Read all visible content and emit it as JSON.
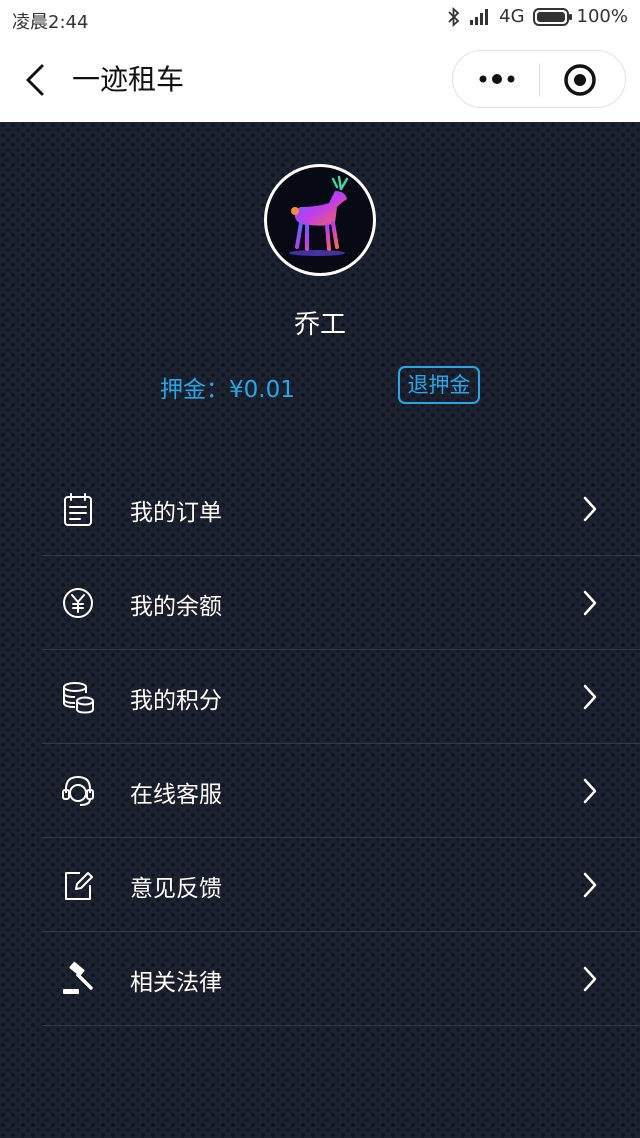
{
  "status_bar": {
    "time": "凌晨2:44",
    "network": "4G",
    "battery": "100%",
    "icons": [
      "bluetooth-icon",
      "signal-icon",
      "battery-icon"
    ]
  },
  "nav": {
    "title": "一迹租车",
    "icons": [
      "back-arrow-icon",
      "more-dots-icon",
      "target-circle-icon"
    ]
  },
  "profile": {
    "name": "乔工",
    "avatar": "deer-avatar-icon",
    "deposit_label": "押金：¥0.01",
    "refund_label": "退押金"
  },
  "menu": {
    "items": [
      {
        "label": "我的订单",
        "icon": "calendar-list-icon"
      },
      {
        "label": "我的余额",
        "icon": "yuan-coin-icon"
      },
      {
        "label": "我的积分",
        "icon": "coin-stack-icon"
      },
      {
        "label": "在线客服",
        "icon": "headset-icon"
      },
      {
        "label": "意见反馈",
        "icon": "edit-note-icon"
      },
      {
        "label": "相关法律",
        "icon": "gavel-icon"
      }
    ]
  },
  "colors": {
    "accent": "#27a7e8",
    "background": "#1d2231",
    "divider": "#323a4f",
    "text": "#ffffff"
  }
}
